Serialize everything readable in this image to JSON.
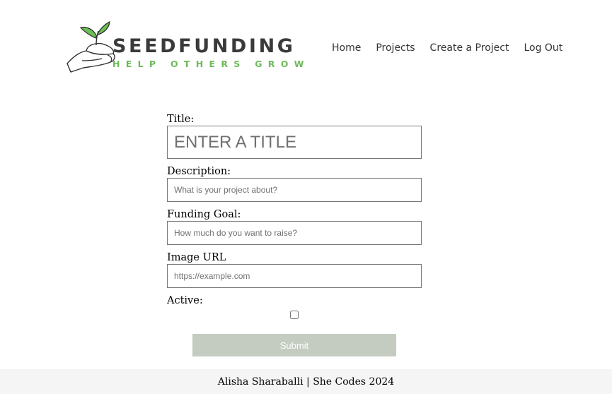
{
  "brand": {
    "name": "SEEDFUNDING",
    "tagline": "HELP OTHERS GROW",
    "name_color": "#3a3a3a",
    "tagline_color": "#6fb95a",
    "logo_icon": "hand-holding-seedling-icon"
  },
  "nav": {
    "items": [
      {
        "label": "Home"
      },
      {
        "label": "Projects"
      },
      {
        "label": "Create a Project"
      },
      {
        "label": "Log Out"
      }
    ]
  },
  "form": {
    "title": {
      "label": "Title:",
      "value": "",
      "placeholder": "ENTER A TITLE"
    },
    "description": {
      "label": "Description:",
      "value": "",
      "placeholder": "What is your project about?"
    },
    "goal": {
      "label": "Funding Goal:",
      "value": "",
      "placeholder": "How much do you want to raise?"
    },
    "image": {
      "label": "Image URL",
      "value": "",
      "placeholder": "https://example.com"
    },
    "active": {
      "label": "Active:",
      "checked": false
    },
    "submit": {
      "label": "Submit",
      "color": "#c4ccc1"
    }
  },
  "footer": {
    "text": "Alisha Sharaballi | She Codes 2024"
  }
}
